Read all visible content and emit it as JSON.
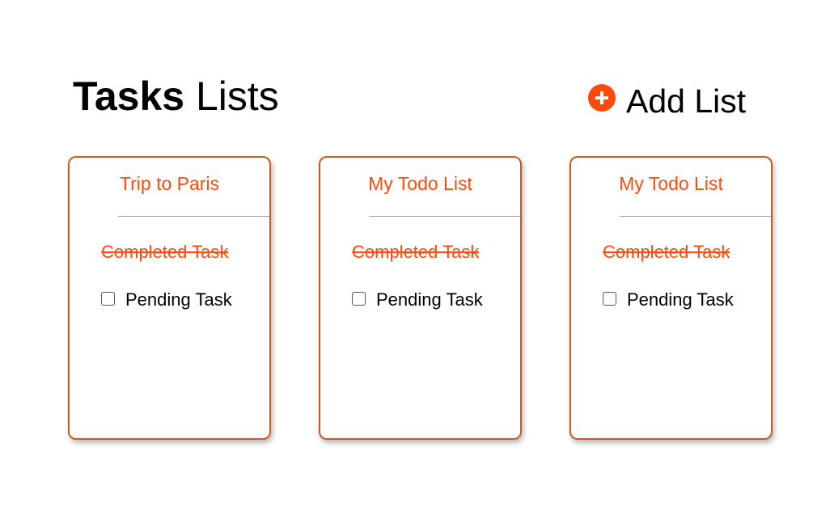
{
  "header": {
    "title_bold": "Tasks",
    "title_rest": "Lists",
    "add_list_label": "Add List",
    "add_icon": "plus-circle-icon"
  },
  "colors": {
    "accent": "#ff4a0a",
    "card_border": "#cc5a1f"
  },
  "lists": [
    {
      "title": "Trip to Paris",
      "completed_task": "Completed Task",
      "pending_task": "Pending Task",
      "pending_checked": false
    },
    {
      "title": "My Todo List",
      "completed_task": "Completed Task",
      "pending_task": "Pending Task",
      "pending_checked": false
    },
    {
      "title": "My Todo List",
      "completed_task": "Completed Task",
      "pending_task": "Pending Task",
      "pending_checked": false
    }
  ]
}
